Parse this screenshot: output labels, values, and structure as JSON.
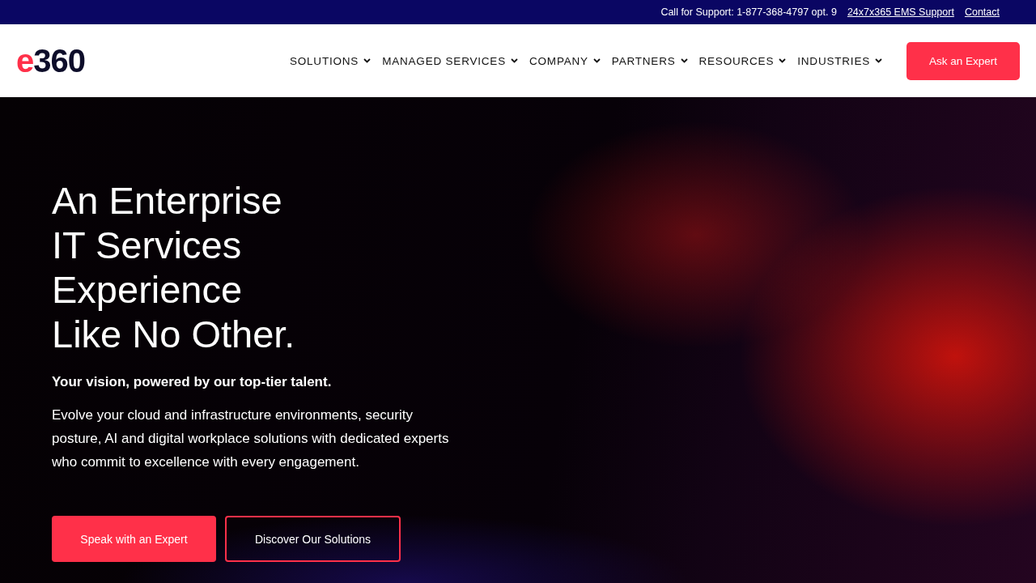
{
  "top_bar": {
    "support_text": "Call for Support: 1-877-368-4797 opt. 9",
    "links": [
      "24x7x365 EMS Support",
      "Contact"
    ]
  },
  "header": {
    "logo": {
      "accent": "e",
      "rest": "360"
    },
    "nav": [
      {
        "label": "SOLUTIONS",
        "has_dropdown": true
      },
      {
        "label": "MANAGED SERVICES",
        "has_dropdown": true
      },
      {
        "label": "COMPANY",
        "has_dropdown": true
      },
      {
        "label": "PARTNERS",
        "has_dropdown": true
      },
      {
        "label": "RESOURCES",
        "has_dropdown": true
      },
      {
        "label": "INDUSTRIES",
        "has_dropdown": true
      }
    ],
    "cta": "Ask an Expert"
  },
  "hero": {
    "headline_lines": [
      "An Enterprise",
      "IT Services",
      "Experience",
      "Like No Other."
    ],
    "tagline": "Your vision, powered by our top-tier talent.",
    "description": "Evolve your cloud and infrastructure environments, security posture, AI and digital workplace solutions with dedicated experts who commit to excellence with every engagement.",
    "buttons": [
      {
        "label": "Speak with an Expert",
        "kind": "primary"
      },
      {
        "label": "Discover Our Solutions",
        "kind": "outline"
      }
    ]
  }
}
